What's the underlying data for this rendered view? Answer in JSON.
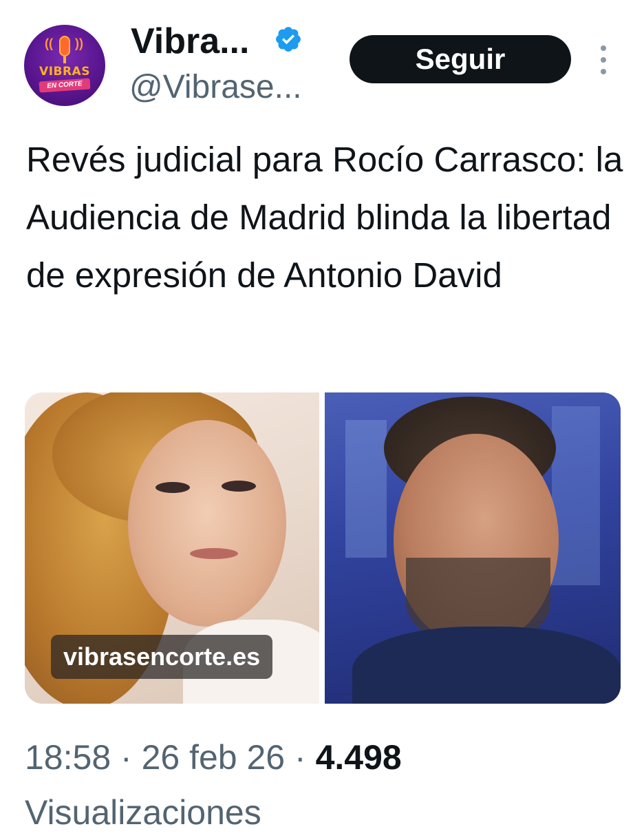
{
  "account": {
    "display_name": "Vibra...",
    "handle": "@Vibrase...",
    "verified": true,
    "avatar_text_main": "VIBRAS",
    "avatar_text_sub": "EN CORTE"
  },
  "actions": {
    "follow_label": "Seguir",
    "more_icon": "more-vertical-icon"
  },
  "tweet": {
    "text": "Revés judicial para Rocío Carrasco: la Audiencia de Madrid blinda la libertad de expresión de Antonio David",
    "media": {
      "count": 2,
      "source_label": "vibrasencorte.es"
    }
  },
  "meta": {
    "time": "18:58",
    "separator": "·",
    "date": "26 feb 26",
    "views_count": "4.498",
    "views_label": "Visualizaciones"
  },
  "colors": {
    "primary_text": "#0f1419",
    "secondary_text": "#536471",
    "verified_blue": "#1d9bf0",
    "follow_button_bg": "#0f1419"
  }
}
